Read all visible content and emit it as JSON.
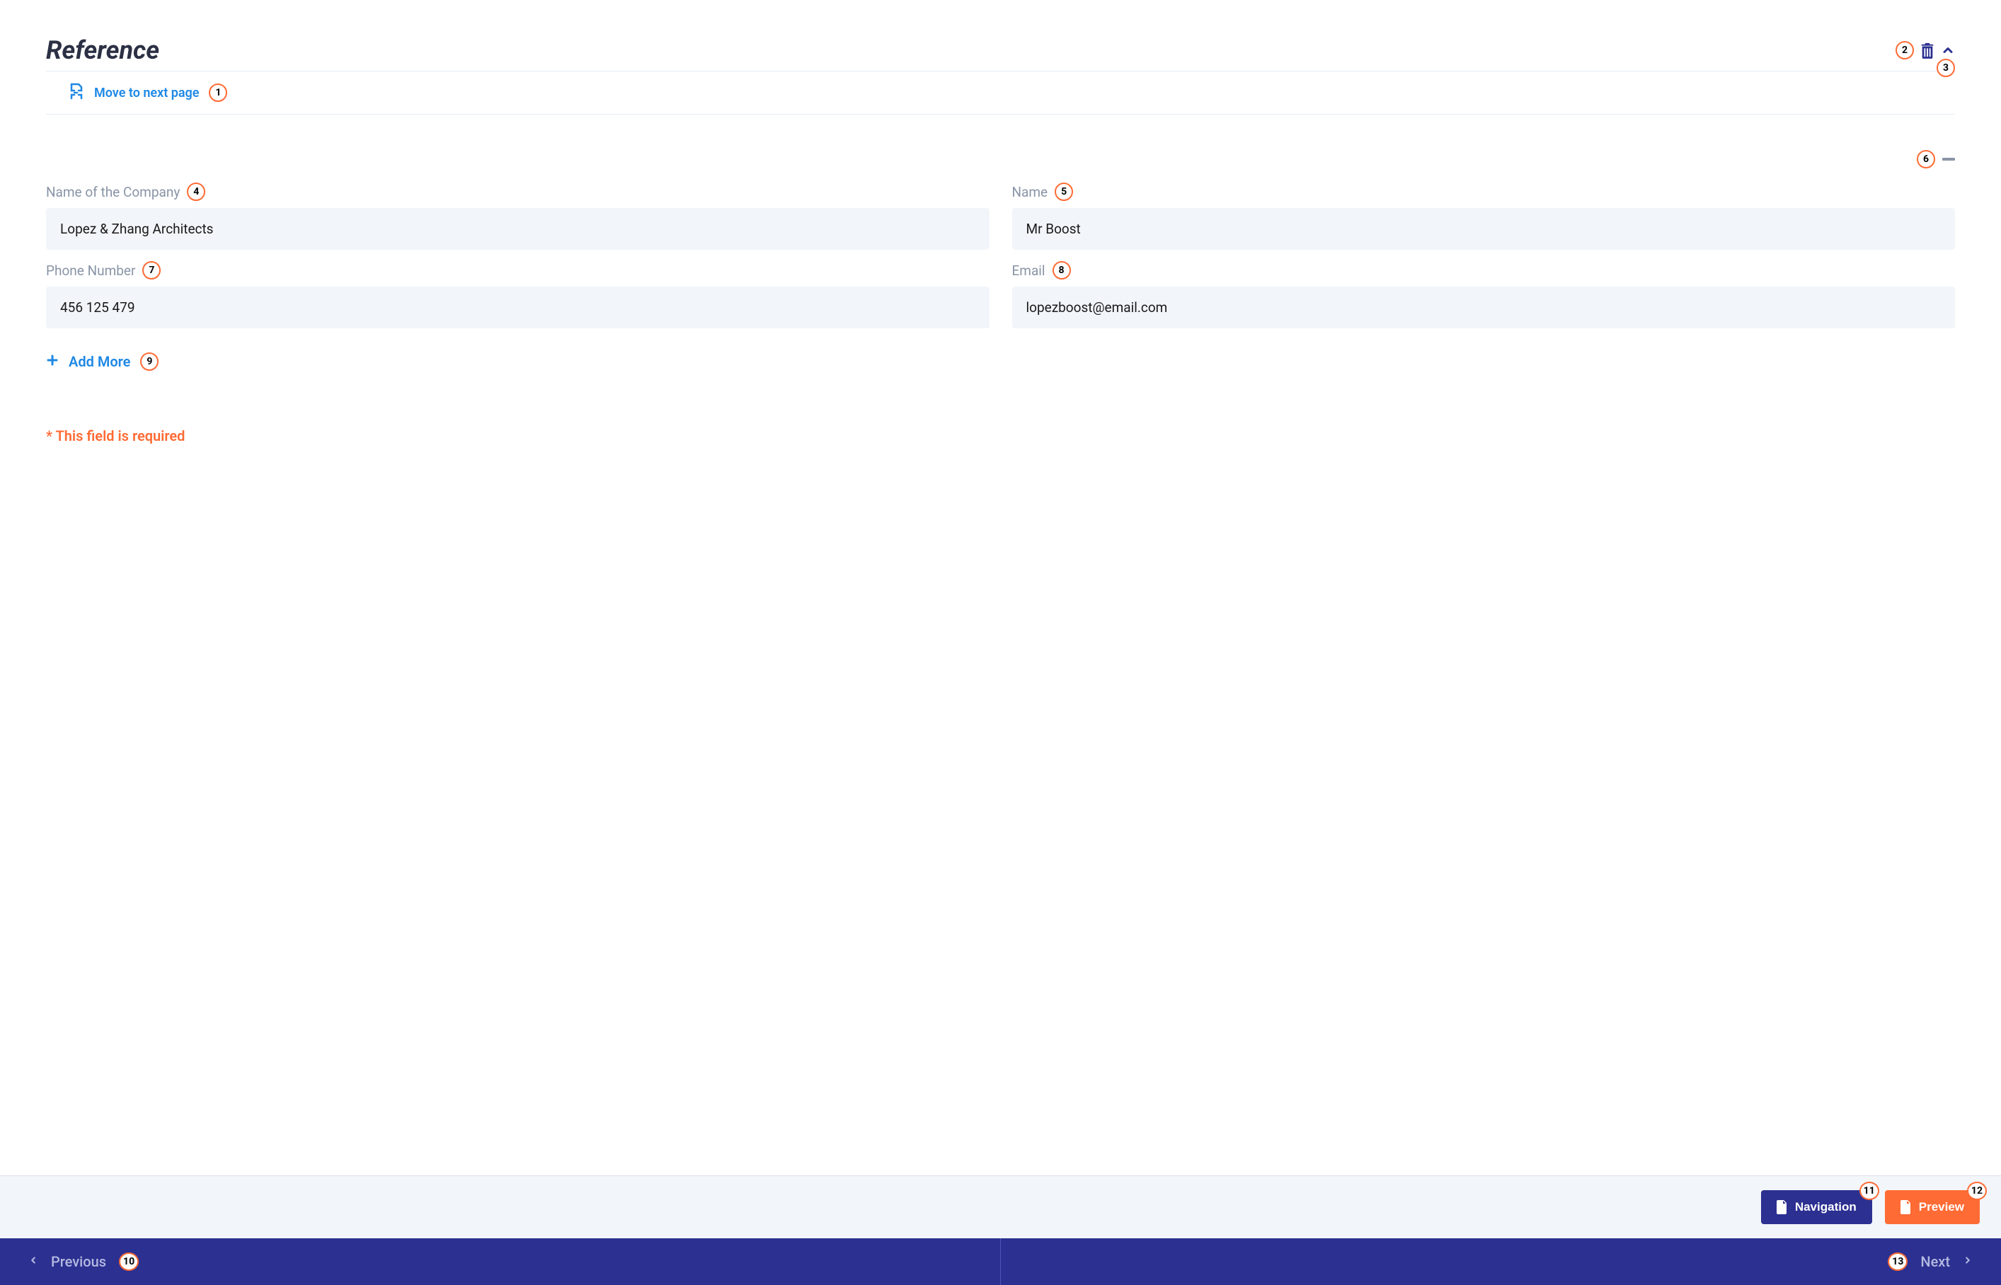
{
  "section_title": "Reference",
  "move_link": "Move to next page",
  "fields": {
    "company_label": "Name of the Company",
    "company_value": "Lopez & Zhang Architects",
    "name_label": "Name",
    "name_value": "Mr Boost",
    "phone_label": "Phone Number",
    "phone_value": "456 125 479",
    "email_label": "Email",
    "email_value": "lopezboost@email.com"
  },
  "add_more": "Add More",
  "required_message": "* This field is required",
  "buttons": {
    "navigation": "Navigation",
    "preview": "Preview"
  },
  "nav": {
    "previous": "Previous",
    "next": "Next"
  },
  "badges": {
    "b1": "1",
    "b2": "2",
    "b3": "3",
    "b4": "4",
    "b5": "5",
    "b6": "6",
    "b7": "7",
    "b8": "8",
    "b9": "9",
    "b10": "10",
    "b11": "11",
    "b12": "12",
    "b13": "13"
  },
  "colors": {
    "primary": "#2c3091",
    "accent": "#ff6b35",
    "link": "#1e88e5",
    "muted": "#8994a6",
    "input_bg": "#f2f5f9"
  }
}
